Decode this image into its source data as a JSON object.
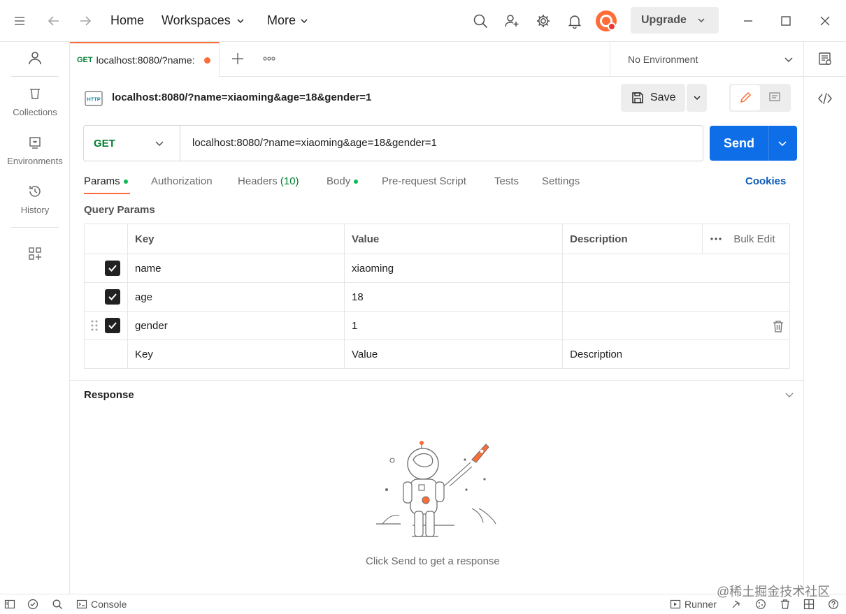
{
  "titlebar": {
    "home": "Home",
    "workspaces": "Workspaces",
    "more": "More",
    "upgrade": "Upgrade"
  },
  "sidebar": {
    "items": [
      {
        "label": "Collections",
        "icon": "trash-can-icon"
      },
      {
        "label": "Environments",
        "icon": "environment-icon"
      },
      {
        "label": "History",
        "icon": "history-icon"
      }
    ]
  },
  "tab": {
    "method": "GET",
    "title": "localhost:8080/?name:",
    "environment": "No Environment"
  },
  "request": {
    "name": "localhost:8080/?name=xiaoming&age=18&gender=1",
    "save": "Save",
    "method": "GET",
    "url": "localhost:8080/?name=xiaoming&age=18&gender=1",
    "send": "Send"
  },
  "subtabs": {
    "params": "Params",
    "authorization": "Authorization",
    "headers": "Headers",
    "headers_count": "(10)",
    "body": "Body",
    "prerequest": "Pre-request Script",
    "tests": "Tests",
    "settings": "Settings",
    "cookies": "Cookies"
  },
  "query": {
    "title": "Query Params",
    "columns": {
      "key": "Key",
      "value": "Value",
      "description": "Description",
      "bulk_edit": "Bulk Edit"
    },
    "rows": [
      {
        "key": "name",
        "value": "xiaoming",
        "description": ""
      },
      {
        "key": "age",
        "value": "18",
        "description": ""
      },
      {
        "key": "gender",
        "value": "1",
        "description": ""
      }
    ],
    "placeholders": {
      "key": "Key",
      "value": "Value",
      "description": "Description"
    }
  },
  "response": {
    "title": "Response",
    "empty_hint": "Click Send to get a response"
  },
  "statusbar": {
    "console": "Console",
    "runner": "Runner",
    "watermark": "@稀土掘金技术社区"
  },
  "colors": {
    "accent": "#ff6c37",
    "send": "#0d6ee8",
    "get_method": "#007f31",
    "active_dot": "#0cbb52",
    "cookies_link": "#0d5bb8"
  }
}
